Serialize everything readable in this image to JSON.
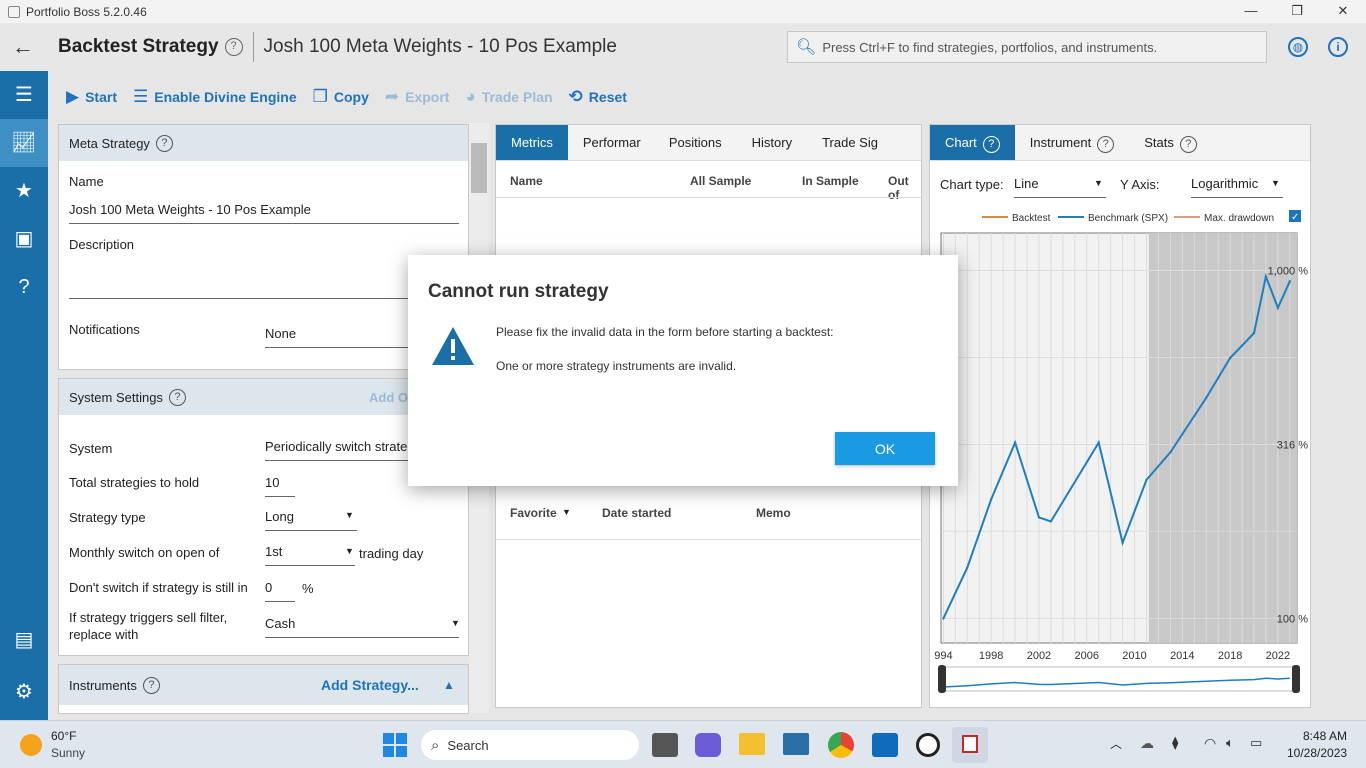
{
  "window": {
    "title": "Portfolio Boss 5.2.0.46"
  },
  "header": {
    "title": "Backtest Strategy",
    "subtitle": "Josh 100 Meta Weights - 10 Pos Example",
    "search_placeholder": "Press Ctrl+F to find strategies, portfolios, and instruments."
  },
  "toolbar": {
    "start": "Start",
    "divine": "Enable Divine Engine",
    "copy": "Copy",
    "export": "Export",
    "trade_plan": "Trade Plan",
    "reset": "Reset"
  },
  "meta": {
    "heading": "Meta Strategy",
    "name_label": "Name",
    "name_value": "Josh 100 Meta Weights - 10 Pos Example",
    "description_label": "Description",
    "notifications_label": "Notifications",
    "notifications_value": "None"
  },
  "system": {
    "heading": "System Settings",
    "add_link": "Add O",
    "system_label": "System",
    "system_value": "Periodically switch strateg",
    "total_label": "Total strategies to hold",
    "total_value": "10",
    "type_label": "Strategy type",
    "type_value": "Long",
    "monthly_label": "Monthly switch on open of",
    "monthly_value": "1st",
    "trading_day": "trading day",
    "dont_switch_label": "Don't switch if strategy is still in",
    "dont_switch_value": "0",
    "percent": "%",
    "sell_filter_label1": "If strategy triggers sell filter,",
    "sell_filter_label2": "replace with",
    "sell_filter_value": "Cash"
  },
  "instruments": {
    "heading": "Instruments",
    "add": "Add Strategy..."
  },
  "middle": {
    "tabs": [
      "Metrics",
      "Performar",
      "Positions",
      "History",
      "Trade Sig"
    ],
    "cols": [
      "Name",
      "All Sample",
      "In Sample",
      "Out of"
    ],
    "cols2": [
      "Favorite",
      "Date started",
      "Memo"
    ]
  },
  "right": {
    "tabs": [
      "Chart",
      "Instrument",
      "Stats"
    ],
    "chart_type_label": "Chart type:",
    "chart_type_value": "Line",
    "yaxis_label": "Y Axis:",
    "yaxis_value": "Logarithmic",
    "legend": [
      "Backtest",
      "Benchmark (SPX)",
      "Max. drawdown"
    ],
    "colors": {
      "backtest": "#d98b3a",
      "benchmark": "#1e7fc0",
      "drawdown": "#d9a07a"
    }
  },
  "chart_data": {
    "type": "line",
    "title": "",
    "ylabel": "",
    "xlabel": "",
    "yscale": "log",
    "ytick_labels": [
      "1,000 %",
      "316 %",
      "100 %"
    ],
    "xtick_labels": [
      "994",
      "1998",
      "2002",
      "2006",
      "2010",
      "2014",
      "2018",
      "2022"
    ],
    "series": [
      {
        "name": "Benchmark (SPX)",
        "x": [
          1994,
          1996,
          1998,
          2000,
          2002,
          2003,
          2007,
          2009,
          2011,
          2013,
          2016,
          2018,
          2020,
          2021,
          2022,
          2023
        ],
        "y": [
          100,
          140,
          220,
          320,
          195,
          190,
          320,
          165,
          250,
          300,
          430,
          560,
          660,
          960,
          780,
          930
        ]
      }
    ],
    "grid": true
  },
  "dialog": {
    "title": "Cannot run strategy",
    "message1": "Please fix the invalid data in the form before starting a backtest:",
    "message2": "One or more strategy instruments are invalid.",
    "ok": "OK"
  },
  "taskbar": {
    "temp": "60°F",
    "weather": "Sunny",
    "search": "Search",
    "time": "8:48 AM",
    "date": "10/28/2023"
  }
}
